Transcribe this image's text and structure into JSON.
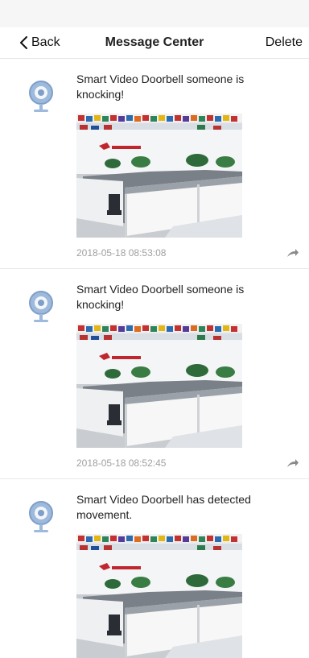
{
  "nav": {
    "back_label": "Back",
    "title": "Message Center",
    "delete_label": "Delete"
  },
  "messages": [
    {
      "text": "Smart  Video Doorbell someone is knocking!",
      "timestamp": "2018-05-18 08:53:08",
      "snapshot_icon": "office-snapshot-image"
    },
    {
      "text": "Smart  Video Doorbell someone is knocking!",
      "timestamp": "2018-05-18 08:52:45",
      "snapshot_icon": "office-snapshot-image"
    },
    {
      "text": "Smart  Video Doorbell has detected movement.",
      "snapshot_icon": "office-snapshot-image"
    }
  ],
  "icons": {
    "back": "chevron-left-icon",
    "device": "doorbell-camera-icon",
    "share": "share-arrow-icon"
  },
  "colors": {
    "device_icon": "#8fb0d6",
    "timestamp": "#a0a0a0",
    "divider": "#e8e8e8"
  }
}
